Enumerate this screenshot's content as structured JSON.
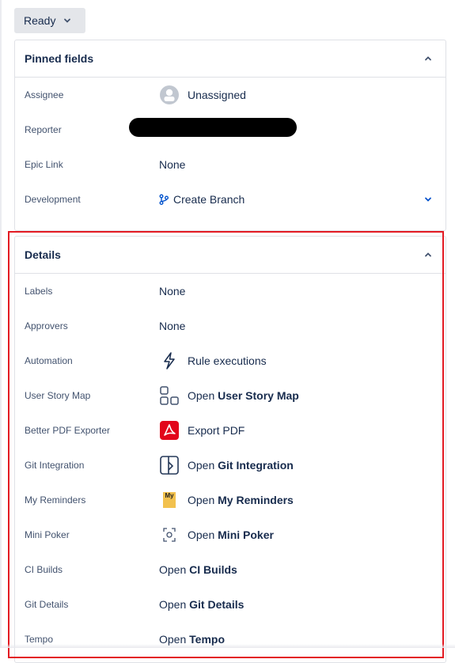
{
  "status": {
    "label": "Ready"
  },
  "pinned": {
    "title": "Pinned fields",
    "assignee": {
      "label": "Assignee",
      "value": "Unassigned"
    },
    "reporter": {
      "label": "Reporter"
    },
    "epic_link": {
      "label": "Epic Link",
      "value": "None"
    },
    "development": {
      "label": "Development",
      "value": "Create Branch"
    }
  },
  "details": {
    "title": "Details",
    "labels": {
      "label": "Labels",
      "value": "None"
    },
    "approvers": {
      "label": "Approvers",
      "value": "None"
    },
    "automation": {
      "label": "Automation",
      "value": "Rule executions"
    },
    "user_story_map": {
      "label": "User Story Map",
      "prefix": "Open",
      "name": "User Story Map"
    },
    "pdf": {
      "label": "Better PDF Exporter",
      "value": "Export PDF"
    },
    "git_integration": {
      "label": "Git Integration",
      "prefix": "Open",
      "name": "Git Integration"
    },
    "reminders": {
      "label": "My Reminders",
      "prefix": "Open",
      "name": "My Reminders",
      "icon_text": "My"
    },
    "poker": {
      "label": "Mini Poker",
      "prefix": "Open",
      "name": "Mini Poker"
    },
    "ci_builds": {
      "label": "CI Builds",
      "prefix": "Open",
      "name": "CI Builds"
    },
    "git_details": {
      "label": "Git Details",
      "prefix": "Open",
      "name": "Git Details"
    },
    "tempo": {
      "label": "Tempo",
      "prefix": "Open",
      "name": "Tempo"
    }
  },
  "colors": {
    "highlight": "#e31b23",
    "link": "#0052cc",
    "pdf_icon": "#e2061b",
    "reminder_icon": "#f2c14e"
  }
}
